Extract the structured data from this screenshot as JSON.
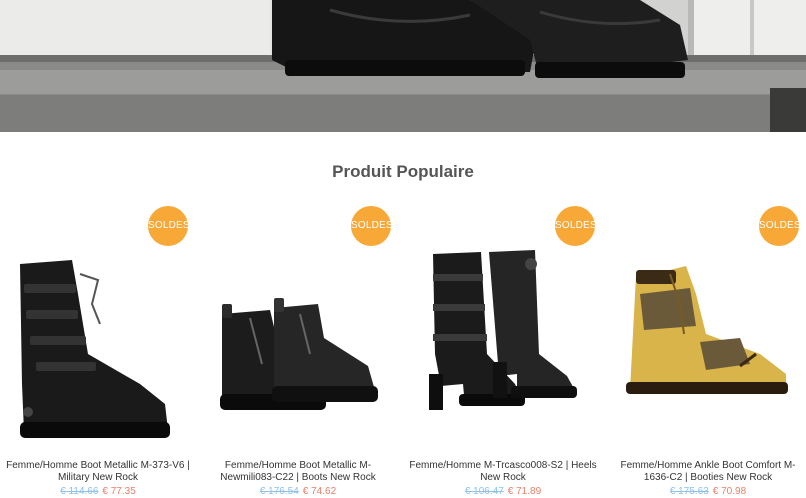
{
  "section": {
    "title": "Produit Populaire"
  },
  "colors": {
    "badge": "#f7a42c",
    "old_price": "#8fc0e8",
    "new_price": "#e8806a"
  },
  "products": [
    {
      "badge": "SOLDES",
      "name": "Femme/Homme Boot Metallic M-373-V6 | Military New Rock",
      "old_price": "€ 114.66",
      "new_price": "€ 77.35",
      "style": "tall-black"
    },
    {
      "badge": "SOLDES",
      "name": "Femme/Homme Boot Metallic M-Newmili083-C22 | Boots New Rock",
      "old_price": "€ 176.54",
      "new_price": "€ 74.62",
      "style": "short-black"
    },
    {
      "badge": "SOLDES",
      "name": "Femme/Homme M-Trcasco008-S2 | Heels New Rock",
      "old_price": "€ 106.47",
      "new_price": "€ 71.89",
      "style": "heel-black"
    },
    {
      "badge": "SOLDES",
      "name": "Femme/Homme Ankle Boot Comfort M-1636-C2 | Booties New Rock",
      "old_price": "€ 175.63",
      "new_price": "€ 70.98",
      "style": "gold"
    }
  ]
}
